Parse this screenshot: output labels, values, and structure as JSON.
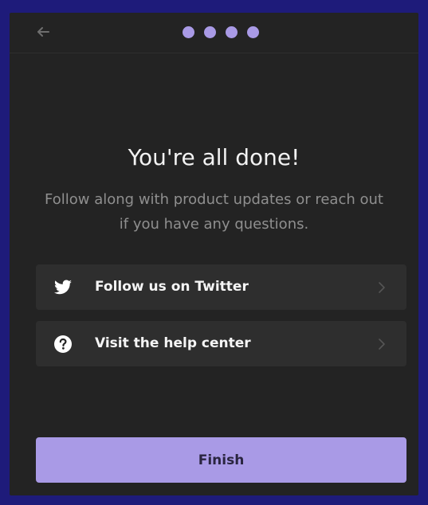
{
  "header": {
    "back_icon": "arrow-left-icon",
    "progress_steps": 4
  },
  "main": {
    "title": "You're all done!",
    "subtitle": "Follow along with product updates or reach out if you have any questions."
  },
  "actions": [
    {
      "label": "Follow us on Twitter",
      "icon": "twitter-icon"
    },
    {
      "label": "Visit the help center",
      "icon": "question-circle-icon"
    }
  ],
  "footer": {
    "finish_label": "Finish"
  },
  "colors": {
    "accent": "#a99ae6",
    "panel": "#232323",
    "card": "#2e2e2e",
    "border": "#1e1b7a"
  }
}
